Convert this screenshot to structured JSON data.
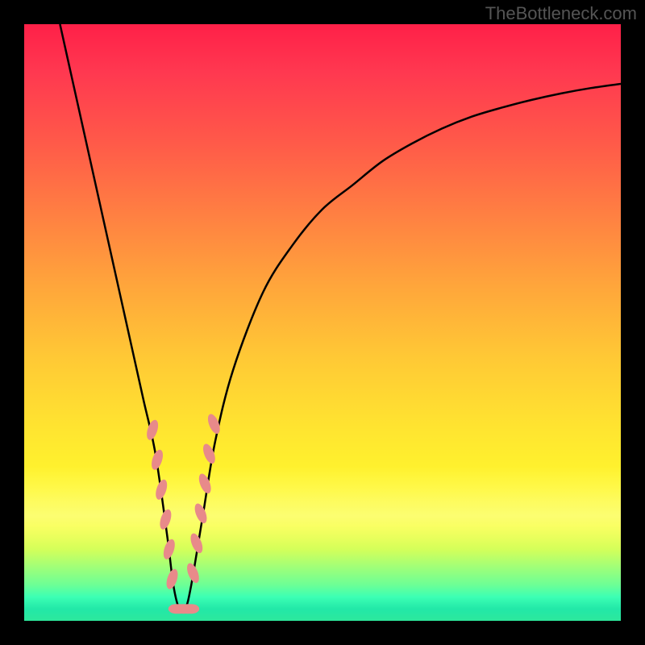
{
  "watermark": "TheBottleneck.com",
  "chart_data": {
    "type": "line",
    "title": "",
    "xlabel": "",
    "ylabel": "",
    "xlim": [
      0,
      100
    ],
    "ylim": [
      0,
      100
    ],
    "series": [
      {
        "name": "bottleneck-curve",
        "x": [
          6,
          8,
          10,
          12,
          14,
          16,
          18,
          20,
          22,
          24,
          25,
          26,
          27,
          28,
          30,
          32,
          35,
          40,
          45,
          50,
          55,
          60,
          65,
          70,
          75,
          80,
          85,
          90,
          95,
          100
        ],
        "values": [
          100,
          91,
          82,
          73,
          64,
          55,
          46,
          37,
          28,
          14,
          6,
          2,
          2,
          6,
          18,
          30,
          42,
          55,
          63,
          69,
          73,
          77,
          80,
          82.5,
          84.5,
          86,
          87.3,
          88.4,
          89.3,
          90
        ]
      }
    ],
    "markers": {
      "left_cluster_x": [
        21.5,
        22.3,
        23.0,
        23.7,
        24.3,
        24.8
      ],
      "left_cluster_y": [
        32,
        27,
        22,
        17,
        12,
        7
      ],
      "bottom_cluster_x": [
        25.5,
        26.0,
        26.7,
        27.4,
        28.0
      ],
      "bottom_cluster_y": [
        2,
        2,
        2,
        2,
        2
      ],
      "right_cluster_x": [
        28.3,
        28.9,
        29.6,
        30.3,
        31.0,
        31.8
      ],
      "right_cluster_y": [
        8,
        13,
        18,
        23,
        28,
        33
      ]
    },
    "gradient_colors": {
      "top": "#ff2048",
      "mid_upper": "#ffa63b",
      "mid": "#ffe530",
      "mid_lower": "#d4ff5a",
      "bottom": "#2de89c"
    }
  }
}
